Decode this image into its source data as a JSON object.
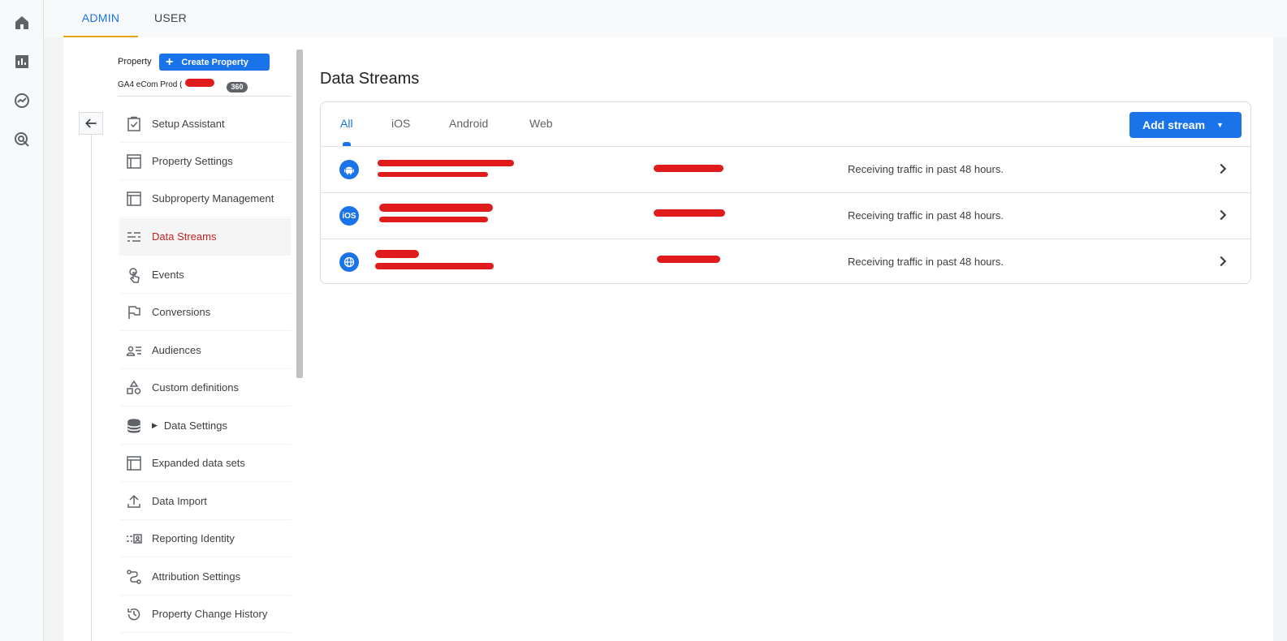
{
  "top_tabs": {
    "admin": "ADMIN",
    "user": "USER"
  },
  "property": {
    "label": "Property",
    "create_button": "Create Property",
    "create_icon": "+",
    "name": "GA4 eCom Prod (",
    "badge": "360"
  },
  "nav": [
    {
      "label": "Setup Assistant",
      "icon": "checklist-icon"
    },
    {
      "label": "Property Settings",
      "icon": "panel-icon"
    },
    {
      "label": "Subproperty Management",
      "icon": "panel-icon"
    },
    {
      "label": "Data Streams",
      "icon": "streams-icon",
      "active": true
    },
    {
      "label": "Events",
      "icon": "touch-icon"
    },
    {
      "label": "Conversions",
      "icon": "flag-icon"
    },
    {
      "label": "Audiences",
      "icon": "audience-icon"
    },
    {
      "label": "Custom definitions",
      "icon": "shapes-icon"
    },
    {
      "label": "Data Settings",
      "icon": "database-icon",
      "expandable": true
    },
    {
      "label": "Expanded data sets",
      "icon": "panel-icon"
    },
    {
      "label": "Data Import",
      "icon": "upload-icon"
    },
    {
      "label": "Reporting Identity",
      "icon": "identity-icon"
    },
    {
      "label": "Attribution Settings",
      "icon": "attribution-icon"
    },
    {
      "label": "Property Change History",
      "icon": "history-icon"
    }
  ],
  "content": {
    "title": "Data Streams",
    "tabs": [
      "All",
      "iOS",
      "Android",
      "Web"
    ],
    "active_tab": "All",
    "add_button": "Add stream",
    "streams": [
      {
        "platform": "android-icon",
        "status": "Receiving traffic in past 48 hours."
      },
      {
        "platform": "ios-icon",
        "platform_label": "iOS",
        "status": "Receiving traffic in past 48 hours."
      },
      {
        "platform": "web-globe-icon",
        "status": "Receiving traffic in past 48 hours."
      }
    ]
  },
  "colors": {
    "accent": "#1a73e8",
    "active_nav": "#c5221f",
    "tab_underline": "#e8a317",
    "redaction": "#e01b1b"
  }
}
